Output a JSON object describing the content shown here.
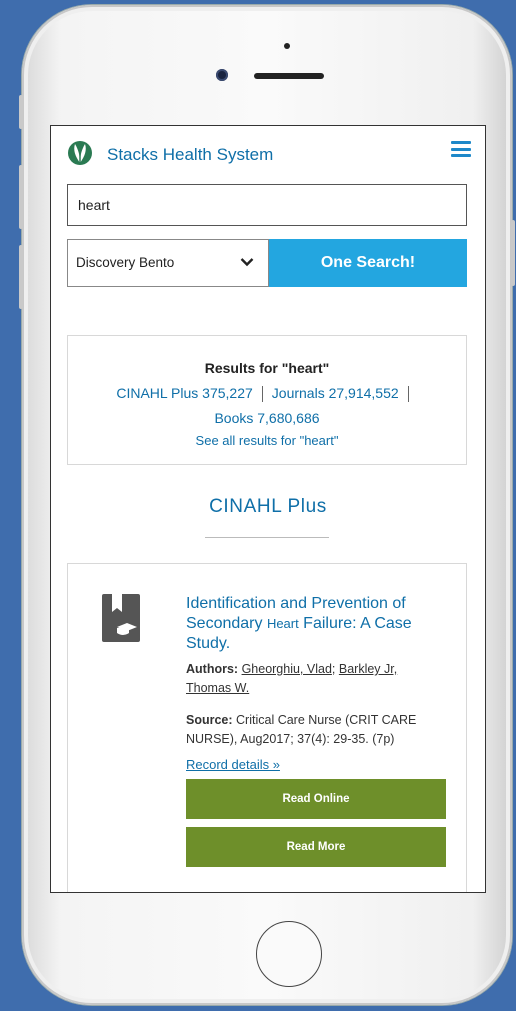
{
  "site": {
    "name": "Stacks Health System"
  },
  "search": {
    "query": "heart",
    "scope": "Discovery Bento",
    "button": "One Search!"
  },
  "results": {
    "title": "Results for \"heart\"",
    "sources": [
      {
        "label": "CINAHL Plus 375,227"
      },
      {
        "label": "Journals 27,914,552"
      },
      {
        "label": "Books 7,680,686"
      }
    ],
    "see_all": "See all results for \"heart\""
  },
  "section": {
    "title": "CINAHL Plus"
  },
  "record": {
    "title_part1": "Identification and Prevention of Secondary ",
    "title_highlight": "Heart",
    "title_part2": " Failure: A Case Study.",
    "authors_label": "Authors:",
    "author1": "Gheorghiu, Vlad",
    "author_sep": ";",
    "author2": "Barkley Jr, Thomas W.",
    "source_label": "Source:",
    "source_text": "Critical Care Nurse (CRIT CARE NURSE), Aug2017; 37(4): 29-35. (7p)",
    "details_link": "Record details »",
    "read_online": "Read Online",
    "read_more": "Read More"
  },
  "colors": {
    "brand": "#0f6fa8",
    "search_button": "#23a6e0",
    "action_button": "#6e8f2a",
    "background": "#3f6dad"
  }
}
